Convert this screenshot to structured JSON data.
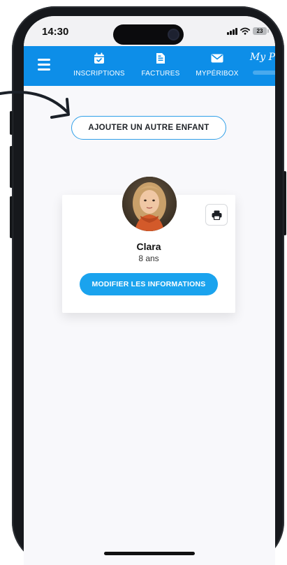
{
  "status_bar": {
    "time": "14:30",
    "battery": "23",
    "icons": [
      "signal-icon",
      "wifi-icon",
      "battery-icon"
    ]
  },
  "navbar": {
    "background": "#0d8ee8",
    "items": [
      {
        "label": "INSCRIPTIONS",
        "icon": "calendar-check-icon"
      },
      {
        "label": "FACTURES",
        "icon": "invoice-icon"
      },
      {
        "label": "MYPÉRIBOX",
        "icon": "mail-icon"
      }
    ],
    "brand": "My P"
  },
  "main": {
    "add_child_label": "AJOUTER UN AUTRE ENFANT",
    "child": {
      "name": "Clara",
      "age": "8 ans",
      "edit_label": "MODIFIER LES INFORMATIONS"
    }
  },
  "colors": {
    "accent": "#1aa3ee",
    "outline": "#2f9fe8"
  }
}
